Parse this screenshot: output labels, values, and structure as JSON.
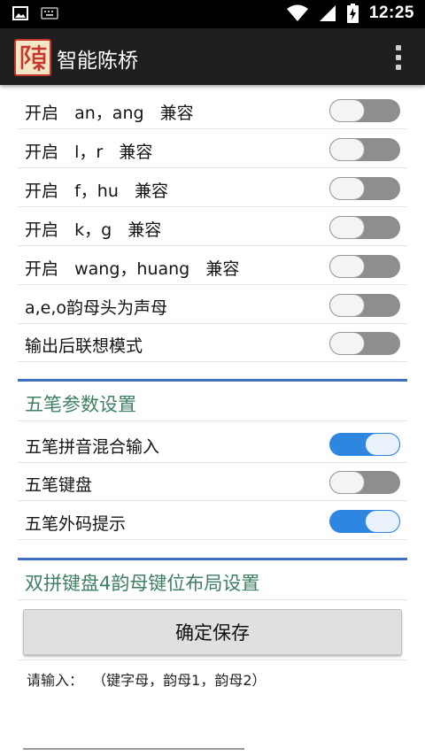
{
  "status_bar": {
    "time": "12:25",
    "icons": [
      "image-icon",
      "keyboard-icon",
      "wifi-icon",
      "signal-icon",
      "battery-charging-icon"
    ]
  },
  "app_bar": {
    "logo_char": "陳",
    "title": "智能陈桥",
    "menu_icon": "overflow-menu-icon"
  },
  "pinyin_options": [
    {
      "label": "开启   an，ang   兼容",
      "on": false
    },
    {
      "label": "开启   l，r   兼容",
      "on": false
    },
    {
      "label": "开启   f，hu   兼容",
      "on": false
    },
    {
      "label": "开启   k，g   兼容",
      "on": false
    },
    {
      "label": "开启   wang，huang   兼容",
      "on": false
    },
    {
      "label": "a,e,o韵母头为声母",
      "on": false
    },
    {
      "label": "输出后联想模式",
      "on": false
    }
  ],
  "wubi_section": {
    "title": "五笔参数设置",
    "options": [
      {
        "label": "五笔拼音混合输入",
        "on": true
      },
      {
        "label": "五笔键盘",
        "on": false
      },
      {
        "label": "五笔外码提示",
        "on": true
      }
    ]
  },
  "shuangpin_section": {
    "title": "双拼键盘4韵母键位布局设置"
  },
  "confirm_button": "确定保存",
  "hint_text": "请输入：  （键字母，韵母1，韵母2）",
  "colors": {
    "accent": "#2f86e0",
    "section_title": "#3f7f62",
    "section_rule": "#3f6fc2",
    "toolbar": "#1f1f1f"
  }
}
